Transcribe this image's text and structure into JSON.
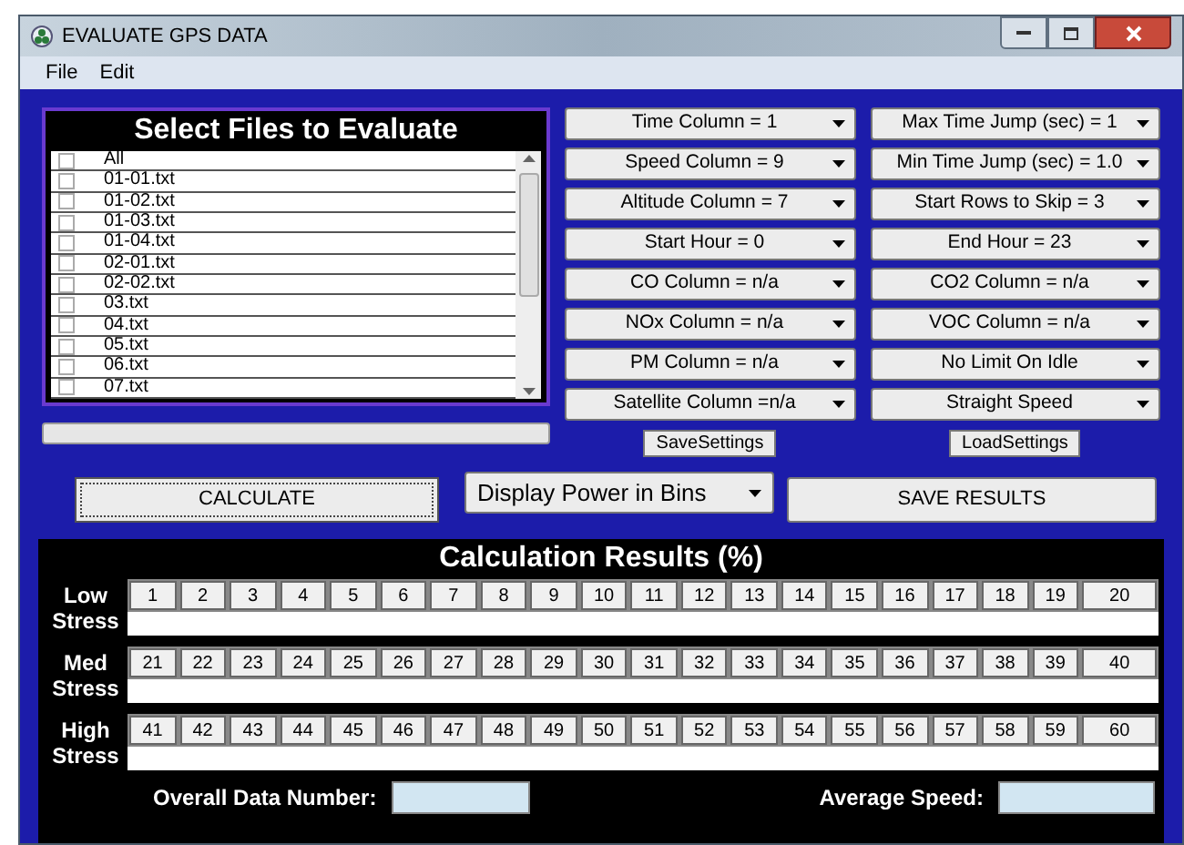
{
  "window": {
    "title": "EVALUATE GPS DATA"
  },
  "menu": [
    "File",
    "Edit"
  ],
  "file_list": {
    "title": "Select Files to Evaluate",
    "items": [
      {
        "label": "All",
        "checked": false
      },
      {
        "label": "01-01.txt",
        "checked": false
      },
      {
        "label": "01-02.txt",
        "checked": false
      },
      {
        "label": "01-03.txt",
        "checked": false
      },
      {
        "label": "01-04.txt",
        "checked": false
      },
      {
        "label": "02-01.txt",
        "checked": false
      },
      {
        "label": "02-02.txt",
        "checked": false
      },
      {
        "label": "03.txt",
        "checked": false
      },
      {
        "label": "04.txt",
        "checked": false
      },
      {
        "label": "05.txt",
        "checked": false
      },
      {
        "label": "06.txt",
        "checked": false
      },
      {
        "label": "07.txt",
        "checked": false
      }
    ]
  },
  "settings": [
    "Time Column = 1",
    "Max Time Jump (sec) = 1",
    "Speed Column = 9",
    "Min Time Jump (sec) = 1.0",
    "Altitude Column = 7",
    "Start Rows to Skip = 3",
    "Start Hour = 0",
    "End Hour = 23",
    "CO Column = n/a",
    "CO2 Column = n/a",
    "NOx Column = n/a",
    "VOC Column = n/a",
    "PM Column = n/a",
    "No Limit On Idle",
    "Satellite Column =n/a",
    "Straight Speed"
  ],
  "settings_buttons": [
    "SaveSettings",
    "LoadSettings"
  ],
  "calculate_button": "CALCULATE",
  "display_mode": "Display Power in Bins",
  "save_results_button": "SAVE RESULTS",
  "results": {
    "title": "Calculation Results (%)",
    "rows": [
      {
        "label": "Low Stress",
        "bins": [
          "1",
          "2",
          "3",
          "4",
          "5",
          "6",
          "7",
          "8",
          "9",
          "10",
          "11",
          "12",
          "13",
          "14",
          "15",
          "16",
          "17",
          "18",
          "19",
          "20"
        ]
      },
      {
        "label": "Med Stress",
        "bins": [
          "21",
          "22",
          "23",
          "24",
          "25",
          "26",
          "27",
          "28",
          "29",
          "30",
          "31",
          "32",
          "33",
          "34",
          "35",
          "36",
          "37",
          "38",
          "39",
          "40"
        ]
      },
      {
        "label": "High Stress",
        "bins": [
          "41",
          "42",
          "43",
          "44",
          "45",
          "46",
          "47",
          "48",
          "49",
          "50",
          "51",
          "52",
          "53",
          "54",
          "55",
          "56",
          "57",
          "58",
          "59",
          "60"
        ]
      }
    ],
    "overall_label": "Overall Data Number:",
    "average_label": "Average Speed:"
  }
}
